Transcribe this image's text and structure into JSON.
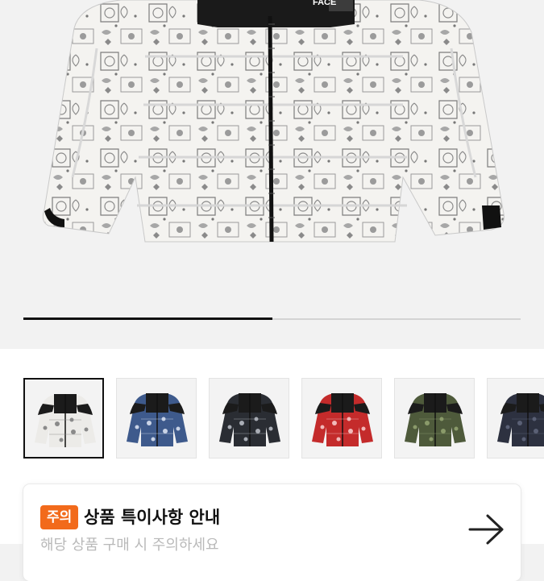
{
  "product": {
    "brand_logo_text": "FACE"
  },
  "gallery": {
    "image_count": 8,
    "progress_fraction": 0.5
  },
  "thumbnails": [
    {
      "name": "white-bandana",
      "body": "#ecebe8",
      "pattern": "#8a8a8a",
      "selected": true
    },
    {
      "name": "blue-bandana",
      "body": "#3e5a8c",
      "pattern": "#c9d3e6",
      "selected": false
    },
    {
      "name": "black-bandana",
      "body": "#2a2d33",
      "pattern": "#a9adb5",
      "selected": false
    },
    {
      "name": "red-bandana",
      "body": "#c42b2b",
      "pattern": "#f1b9b9",
      "selected": false
    },
    {
      "name": "green-camo",
      "body": "#4e5a3b",
      "pattern": "#8a9a6a",
      "selected": false
    },
    {
      "name": "navy-camo",
      "body": "#2d3140",
      "pattern": "#5a6075",
      "selected": false
    }
  ],
  "notice": {
    "badge": "주의",
    "title": "상품 특이사항 안내",
    "subtitle": "해당 상품 구매 시 주의하세요",
    "arrow_icon": "arrow-right-icon",
    "badge_color": "#f26a1b"
  }
}
